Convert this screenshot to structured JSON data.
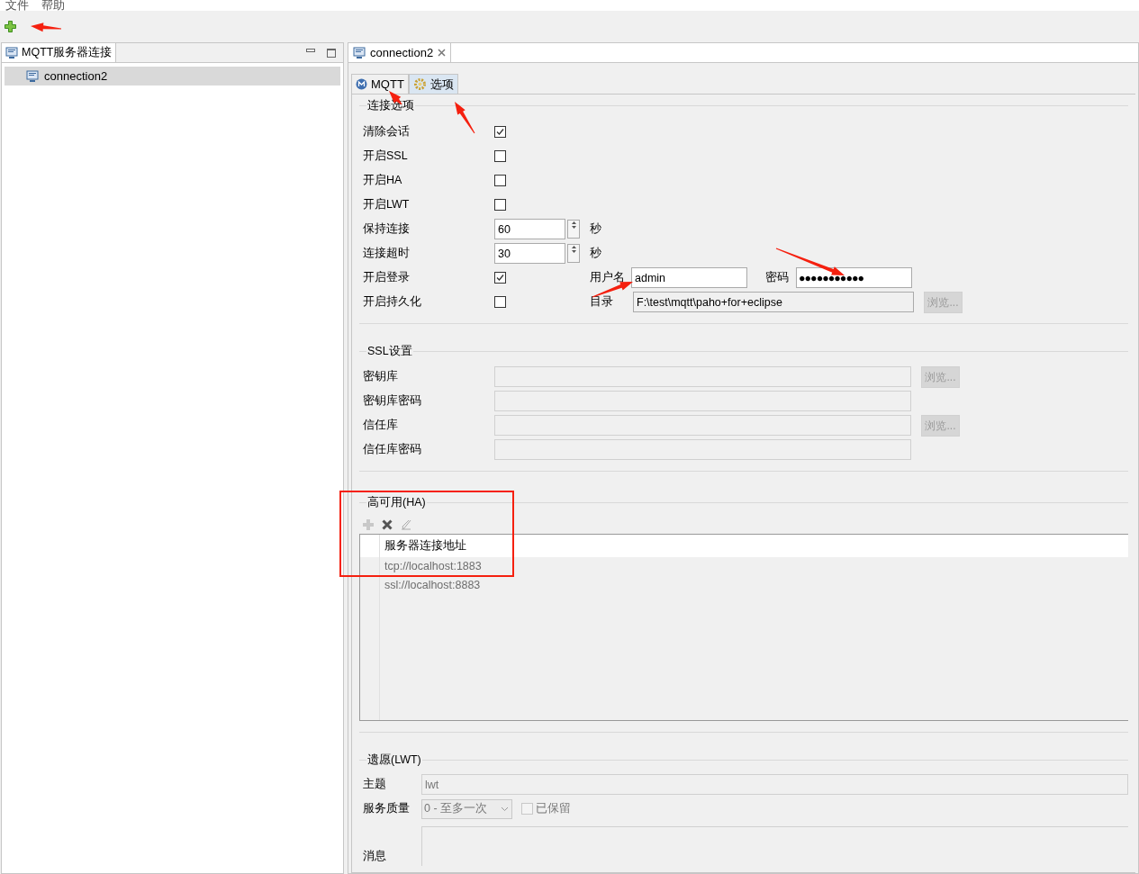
{
  "menu": [
    "文件",
    "帮助"
  ],
  "left_view": {
    "title": "MQTT服务器连接",
    "tree": [
      {
        "label": "connection2",
        "selected": true
      }
    ]
  },
  "editor": {
    "tab": "connection2",
    "inner_tabs": [
      {
        "label": "MQTT",
        "selected": false,
        "kind": "mqtt"
      },
      {
        "label": "选项",
        "selected": true,
        "kind": "gear"
      }
    ],
    "connection_options": {
      "title": "连接选项",
      "rows": [
        {
          "label": "清除会话",
          "kind": "checkbox",
          "checked": true
        },
        {
          "label": "开启SSL",
          "kind": "checkbox",
          "checked": false
        },
        {
          "label": "开启HA",
          "kind": "checkbox",
          "checked": false
        },
        {
          "label": "开启LWT",
          "kind": "checkbox",
          "checked": false
        },
        {
          "label": "保持连接",
          "kind": "spinner",
          "value": "60",
          "unit": "秒"
        },
        {
          "label": "连接超时",
          "kind": "spinner",
          "value": "30",
          "unit": "秒"
        },
        {
          "label": "开启登录",
          "kind": "checkbox",
          "checked": true,
          "extra": {
            "kind": "credentials",
            "username_label": "用户名",
            "username": "admin",
            "password_label": "密码",
            "password": "●●●●●●●●●●●"
          }
        },
        {
          "label": "开启持久化",
          "kind": "checkbox",
          "checked": false,
          "extra": {
            "kind": "directory",
            "label": "目录",
            "value": "F:\\test\\mqtt\\paho+for+eclipse",
            "browse": "浏览...",
            "disabled": true
          }
        }
      ]
    },
    "ssl": {
      "title": "SSL设置",
      "rows": [
        {
          "label": "密钥库",
          "browse": "浏览..."
        },
        {
          "label": "密钥库密码"
        },
        {
          "label": "信任库",
          "browse": "浏览..."
        },
        {
          "label": "信任库密码"
        }
      ]
    },
    "ha": {
      "title": "高可用(HA)",
      "header": "服务器连接地址",
      "rows": [
        "tcp://localhost:1883",
        "ssl://localhost:8883"
      ]
    },
    "lwt": {
      "title": "遗愿(LWT)",
      "topic_label": "主题",
      "topic": "lwt",
      "qos_label": "服务质量",
      "qos": "0 - 至多一次",
      "retained": {
        "label": "已保留",
        "checked": false
      },
      "message_label": "消息"
    }
  }
}
